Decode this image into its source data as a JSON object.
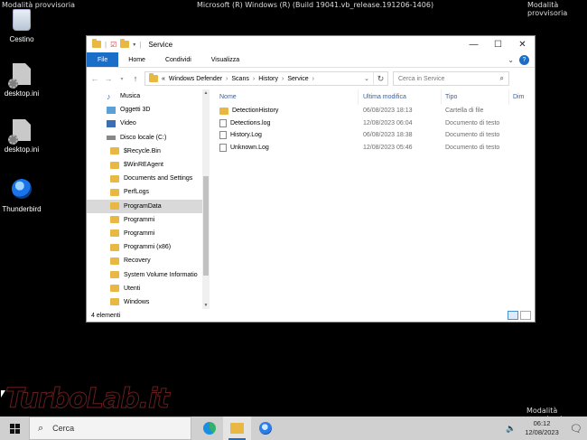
{
  "watermarks": {
    "top_left": "Modalità provvisoria",
    "top_center": "Microsoft (R) Windows (R) (Build 19041.vb_release.191206-1406)",
    "top_right": "Modalità provvisoria",
    "bottom_right": "Modalità provvisoria"
  },
  "desktop_icons": [
    {
      "label": "Cestino",
      "icon": "recycle-bin-icon"
    },
    {
      "label": "desktop.ini",
      "icon": "settings-file-icon"
    },
    {
      "label": "desktop.ini",
      "icon": "settings-file-icon"
    },
    {
      "label": "Thunderbird",
      "icon": "thunderbird-icon"
    }
  ],
  "explorer": {
    "title": "Service",
    "ribbon_tabs": [
      "File",
      "Home",
      "Condividi",
      "Visualizza"
    ],
    "breadcrumb": [
      "Windows Defender",
      "Scans",
      "History",
      "Service"
    ],
    "breadcrumb_overflow": "«",
    "search_placeholder": "Cerca in Service",
    "nav_tree": [
      {
        "label": "Musica",
        "icon": "music-icon",
        "indent": 1
      },
      {
        "label": "Oggetti 3D",
        "icon": "cube-icon",
        "indent": 1
      },
      {
        "label": "Video",
        "icon": "video-icon",
        "indent": 1
      },
      {
        "label": "Disco locale (C:)",
        "icon": "drive-icon",
        "indent": 1
      },
      {
        "label": "$Recycle.Bin",
        "icon": "folder-icon",
        "indent": 2
      },
      {
        "label": "$WinREAgent",
        "icon": "folder-icon",
        "indent": 2
      },
      {
        "label": "Documents and Settings",
        "icon": "folder-shortcut-icon",
        "indent": 2
      },
      {
        "label": "PerfLogs",
        "icon": "folder-icon",
        "indent": 2
      },
      {
        "label": "ProgramData",
        "icon": "folder-icon",
        "indent": 2,
        "selected": true
      },
      {
        "label": "Programmi",
        "icon": "folder-icon",
        "indent": 2
      },
      {
        "label": "Programmi",
        "icon": "folder-shortcut-icon",
        "indent": 2
      },
      {
        "label": "Programmi (x86)",
        "icon": "folder-icon",
        "indent": 2
      },
      {
        "label": "Recovery",
        "icon": "folder-icon",
        "indent": 2
      },
      {
        "label": "System Volume Informatio",
        "icon": "folder-icon",
        "indent": 2
      },
      {
        "label": "Utenti",
        "icon": "folder-icon",
        "indent": 2
      },
      {
        "label": "Windows",
        "icon": "folder-icon",
        "indent": 2
      }
    ],
    "columns": [
      "Nome",
      "Ultima modifica",
      "Tipo",
      "Dim"
    ],
    "files": [
      {
        "name": "DetectionHistory",
        "modified": "06/08/2023 18:13",
        "type": "Cartella di file",
        "icon": "folder-icon"
      },
      {
        "name": "Detections.log",
        "modified": "12/08/2023 06:04",
        "type": "Documento di testo",
        "icon": "text-file-icon"
      },
      {
        "name": "History.Log",
        "modified": "06/08/2023 18:38",
        "type": "Documento di testo",
        "icon": "text-file-icon"
      },
      {
        "name": "Unknown.Log",
        "modified": "12/08/2023 05:46",
        "type": "Documento di testo",
        "icon": "text-file-icon"
      }
    ],
    "status": "4 elementi"
  },
  "logo_text": "TurboLab.it",
  "taskbar": {
    "search_placeholder": "Cerca",
    "time": "06:12",
    "date": "12/08/2023"
  }
}
